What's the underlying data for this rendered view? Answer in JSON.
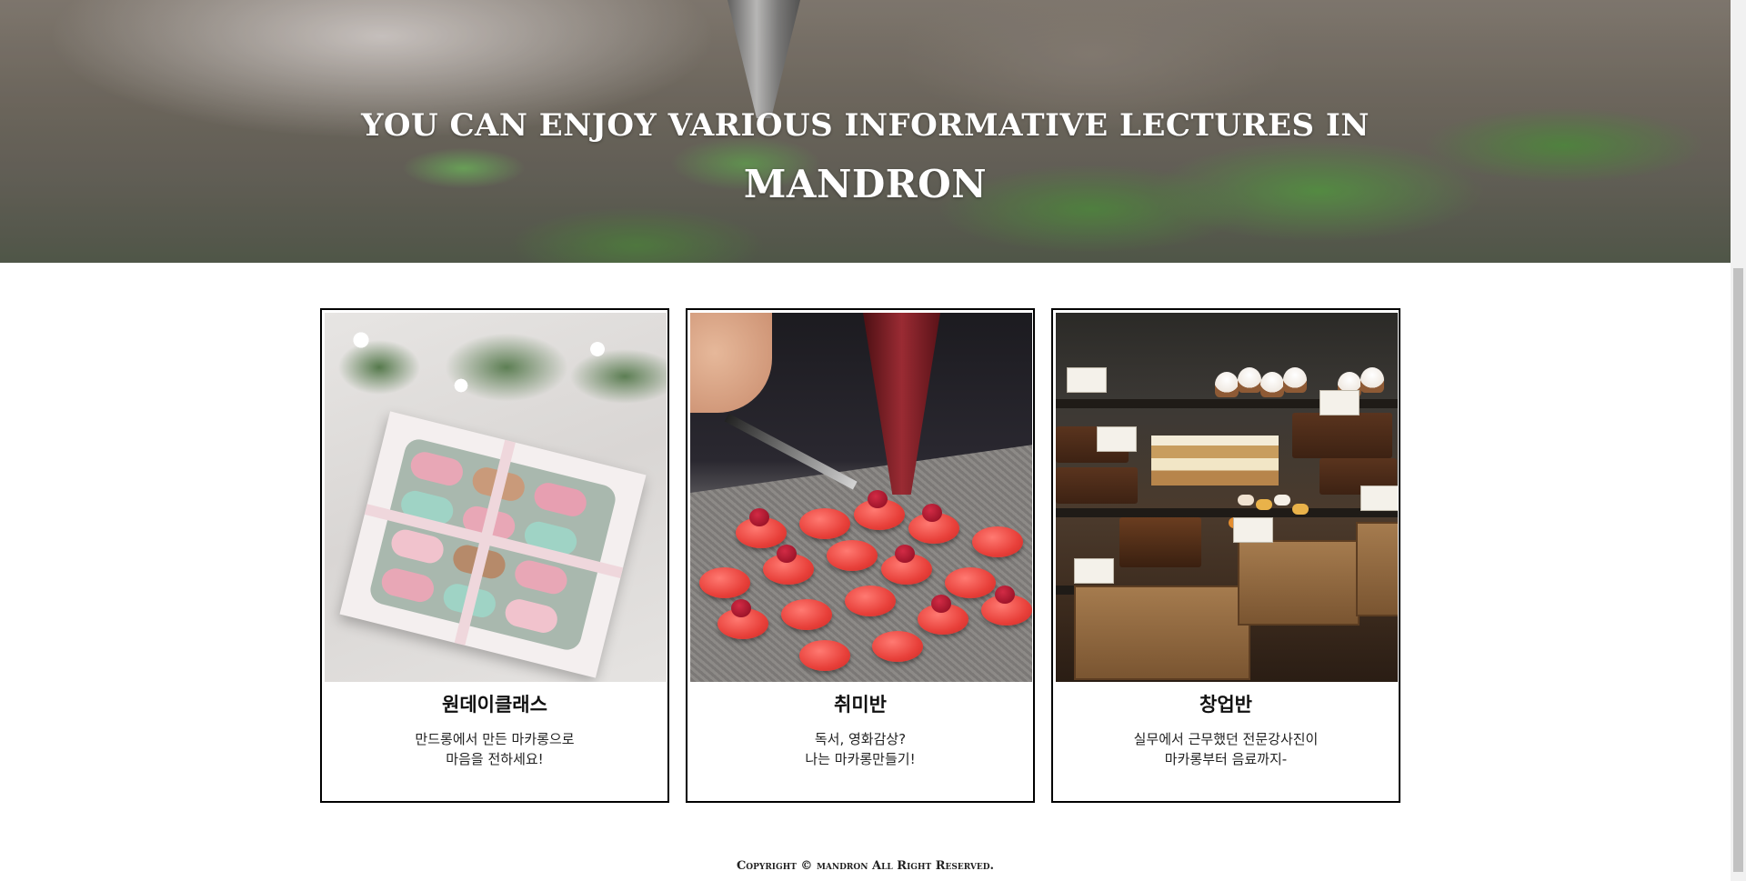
{
  "hero": {
    "line1": "YOU CAN ENJOY VARIOUS INFORMATIVE LECTURES IN",
    "line2": "MANDRON"
  },
  "classes": [
    {
      "title": "원데이클래스",
      "desc_line1": "만드롱에서 만든 마카롱으로",
      "desc_line2": "마음을 전하세요!"
    },
    {
      "title": "취미반",
      "desc_line1": "독서, 영화감상?",
      "desc_line2": "나는 마카롱만들기!"
    },
    {
      "title": "창업반",
      "desc_line1": "실무에서 근무했던 전문강사진이",
      "desc_line2": "마카롱부터 음료까지-"
    }
  ],
  "footer": {
    "text": "Copyright © mandron All Right Reserved."
  }
}
